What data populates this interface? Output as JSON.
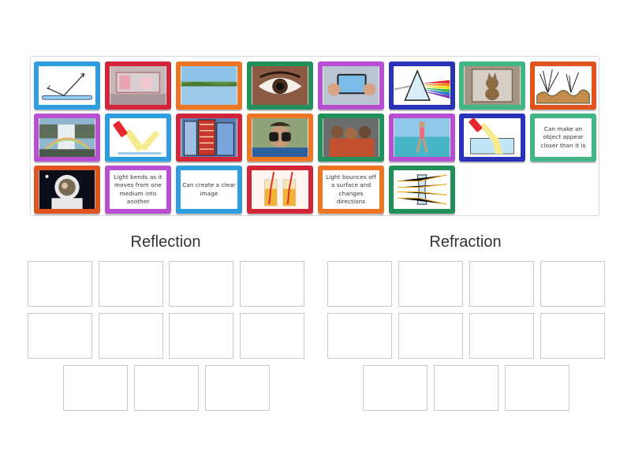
{
  "colors": {
    "blue": "#2f9ee0",
    "red": "#d3253a",
    "orange": "#ee7521",
    "green": "#21905a",
    "purple": "#b84fd2",
    "navy": "#2a33b8",
    "teal": "#44b585",
    "brown_orange": "#e0531d"
  },
  "tray": {
    "cards": [
      {
        "id": "c1",
        "color": "blue",
        "kind": "image",
        "icon": "mirror-reflection-diagram-icon"
      },
      {
        "id": "c2",
        "color": "red",
        "kind": "image",
        "icon": "bathroom-mirror-photo-icon"
      },
      {
        "id": "c3",
        "color": "orange",
        "kind": "image",
        "icon": "lake-reflection-photo-icon"
      },
      {
        "id": "c4",
        "color": "green",
        "kind": "image",
        "icon": "eye-photo-icon"
      },
      {
        "id": "c5",
        "color": "purple",
        "kind": "image",
        "icon": "phone-camera-photo-icon"
      },
      {
        "id": "c6",
        "color": "navy",
        "kind": "image",
        "icon": "prism-rainbow-icon"
      },
      {
        "id": "c7",
        "color": "teal",
        "kind": "image",
        "icon": "cat-mirror-photo-icon"
      },
      {
        "id": "c8",
        "color": "brown_orange",
        "kind": "image",
        "icon": "rough-surface-reflection-icon"
      },
      {
        "id": "c9",
        "color": "purple",
        "kind": "image",
        "icon": "waterfall-rainbow-photo-icon"
      },
      {
        "id": "c10",
        "color": "blue",
        "kind": "image",
        "icon": "flashlight-reflection-icon"
      },
      {
        "id": "c11",
        "color": "red",
        "kind": "image",
        "icon": "glass-building-photo-icon"
      },
      {
        "id": "c12",
        "color": "orange",
        "kind": "image",
        "icon": "binoculars-photo-icon"
      },
      {
        "id": "c13",
        "color": "green",
        "kind": "image",
        "icon": "family-selfie-photo-icon"
      },
      {
        "id": "c14",
        "color": "purple",
        "kind": "image",
        "icon": "underwater-legs-photo-icon"
      },
      {
        "id": "c15",
        "color": "navy",
        "kind": "image",
        "icon": "flashlight-water-refraction-icon"
      },
      {
        "id": "c16",
        "color": "teal",
        "kind": "text",
        "text": "Can make an object appear closer than it is"
      },
      {
        "id": "c17",
        "color": "brown_orange",
        "kind": "image",
        "icon": "astronaut-visor-photo-icon"
      },
      {
        "id": "c18",
        "color": "purple",
        "kind": "text",
        "text": "Light bends as it moves from one medium into another"
      },
      {
        "id": "c19",
        "color": "blue",
        "kind": "text",
        "text": "Can create a clear image"
      },
      {
        "id": "c20",
        "color": "red",
        "kind": "image",
        "icon": "straws-in-glasses-icon"
      },
      {
        "id": "c21",
        "color": "orange",
        "kind": "text",
        "text": "Light bounces off a surface and changes directions"
      },
      {
        "id": "c22",
        "color": "green",
        "kind": "image",
        "icon": "concave-lens-diagram-icon"
      }
    ]
  },
  "groups": [
    {
      "title": "Reflection"
    },
    {
      "title": "Refraction"
    }
  ]
}
